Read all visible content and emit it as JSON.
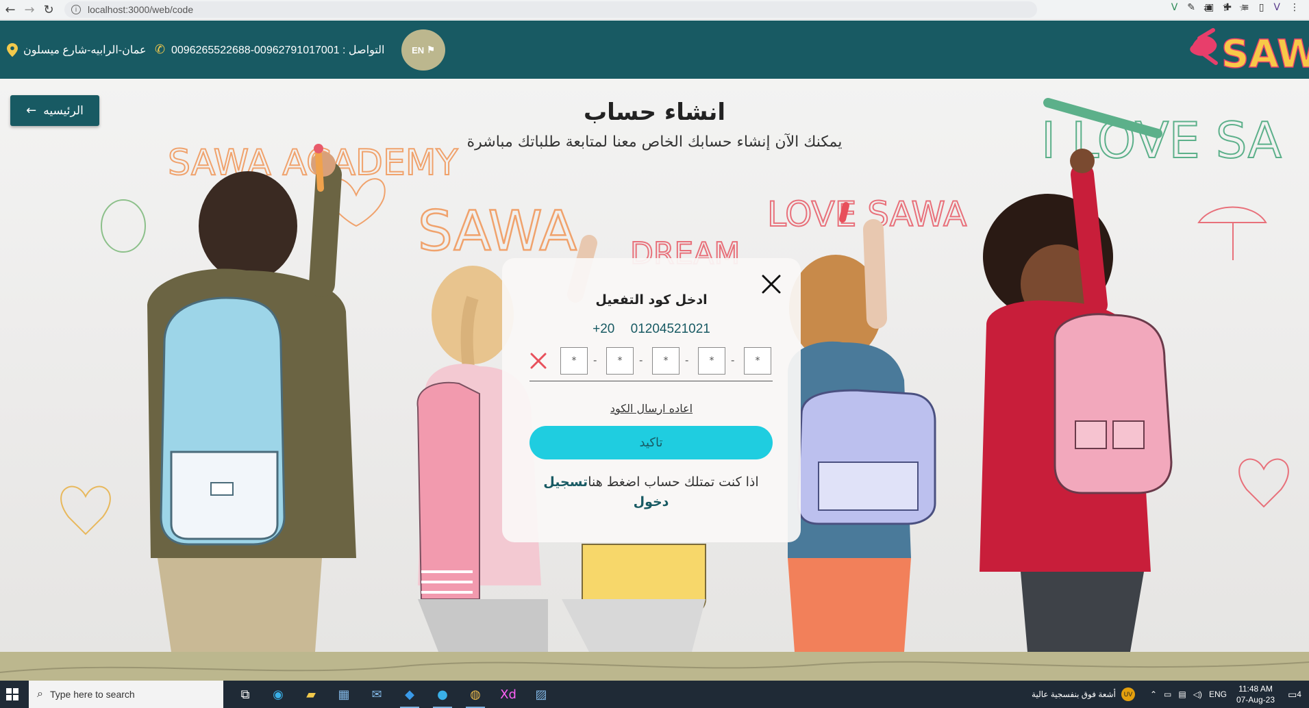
{
  "browser": {
    "url": "localhost:3000/web/code",
    "info_icon": "i"
  },
  "header": {
    "lang_badge": "EN",
    "contact": "التواصل : 00962791017001-0096265522688",
    "address": "عمان-الرابيه-شارع ميسلون",
    "logo_text": "SAWA"
  },
  "hero": {
    "home_button": "الرئيسيه",
    "title": "انشاء حساب",
    "subtitle": "يمكنك الآن إنشاء حسابك الخاص معنا لمتابعة طلباتك مباشرة",
    "wall_text_1": "SAWA ACADEMY",
    "wall_text_2": "SAWA",
    "wall_text_3": "LOVE SAWA",
    "wall_text_4": "I LOVE SA",
    "wall_text_5": "DREAM"
  },
  "modal": {
    "title": "ادخل كود التفعيل",
    "country_code": "+20",
    "phone": "01204521021",
    "code_placeholder": "*",
    "resend": "اعاده ارسال الكود",
    "confirm": "تاكيد",
    "login_prompt": "اذا كنت تمتلك حساب اضغط هنا",
    "login_link": "تسجيل دخول"
  },
  "taskbar": {
    "search_placeholder": "Type here to search",
    "weather": "أشعة فوق بنفسجية عالية",
    "uv_badge": "UV",
    "lang": "ENG",
    "time": "11:48 AM",
    "date": "07-Aug-23",
    "notification_count": "4"
  },
  "colors": {
    "brand_teal": "#185a63",
    "accent_cyan": "#1fcde0",
    "badge_olive": "#bcb78e",
    "close_red": "#e8505b"
  }
}
